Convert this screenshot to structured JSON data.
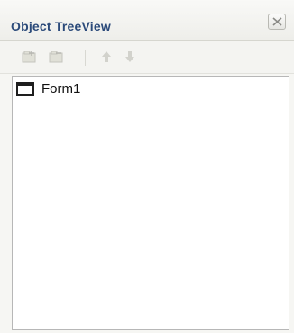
{
  "window": {
    "title": "Object TreeView"
  },
  "toolbar": {
    "buttons": [
      {
        "name": "add-object",
        "icon": "add-node-icon",
        "enabled": false
      },
      {
        "name": "remove-object",
        "icon": "remove-node-icon",
        "enabled": false
      },
      {
        "name": "move-up",
        "icon": "arrow-up-icon",
        "enabled": false
      },
      {
        "name": "move-down",
        "icon": "arrow-down-icon",
        "enabled": false
      }
    ]
  },
  "tree": {
    "nodes": [
      {
        "label": "Form1",
        "icon": "form-window-icon"
      }
    ]
  },
  "colors": {
    "title": "#2b4a7a",
    "panel": "#f6f6f3",
    "tree_border": "#b7b7b7"
  }
}
